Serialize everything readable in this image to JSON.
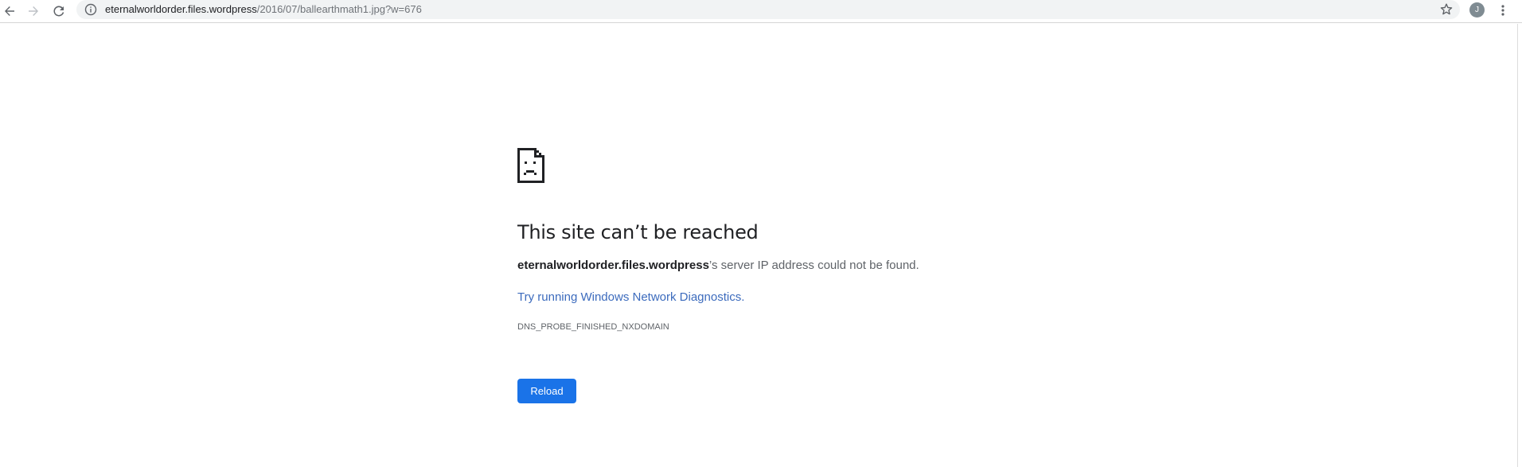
{
  "browser": {
    "url_host": "eternalworldorder.files.wordpress",
    "url_path": "/2016/07/ballearthmath1.jpg?w=676",
    "avatar_initial": "J",
    "icons": {
      "back": "back-arrow-icon",
      "forward": "forward-arrow-icon",
      "reload": "reload-icon",
      "info": "info-icon",
      "bookmark": "star-icon",
      "menu": "kebab-menu-icon"
    }
  },
  "error": {
    "icon": "sad-document-icon",
    "title": "This site can’t be reached",
    "host": "eternalworldorder.files.wordpress",
    "summary_suffix": "’s server IP address could not be found.",
    "diagnostics_link": "Try running Windows Network Diagnostics.",
    "code": "DNS_PROBE_FINISHED_NXDOMAIN",
    "reload_label": "Reload"
  },
  "colors": {
    "accent": "#1a73e8",
    "link": "#3c6bbd",
    "text": "#202124",
    "secondary_text": "#5f6368"
  }
}
